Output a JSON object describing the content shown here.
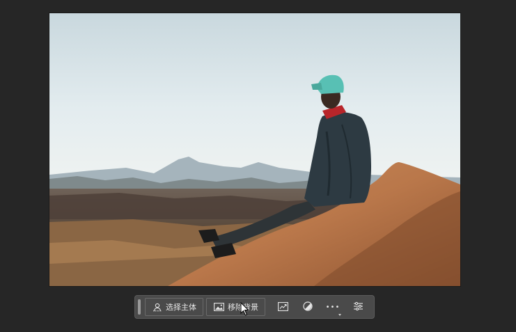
{
  "photo": {
    "subject": "person-sitting-on-sand-dune-icon"
  },
  "taskbar": {
    "select_subject_label": "选择主体",
    "remove_background_label": "移除背景",
    "more_label": "•••"
  },
  "colors": {
    "app_background": "#262626",
    "taskbar_background": "#4a4a4a",
    "text": "#e6e6e6"
  }
}
